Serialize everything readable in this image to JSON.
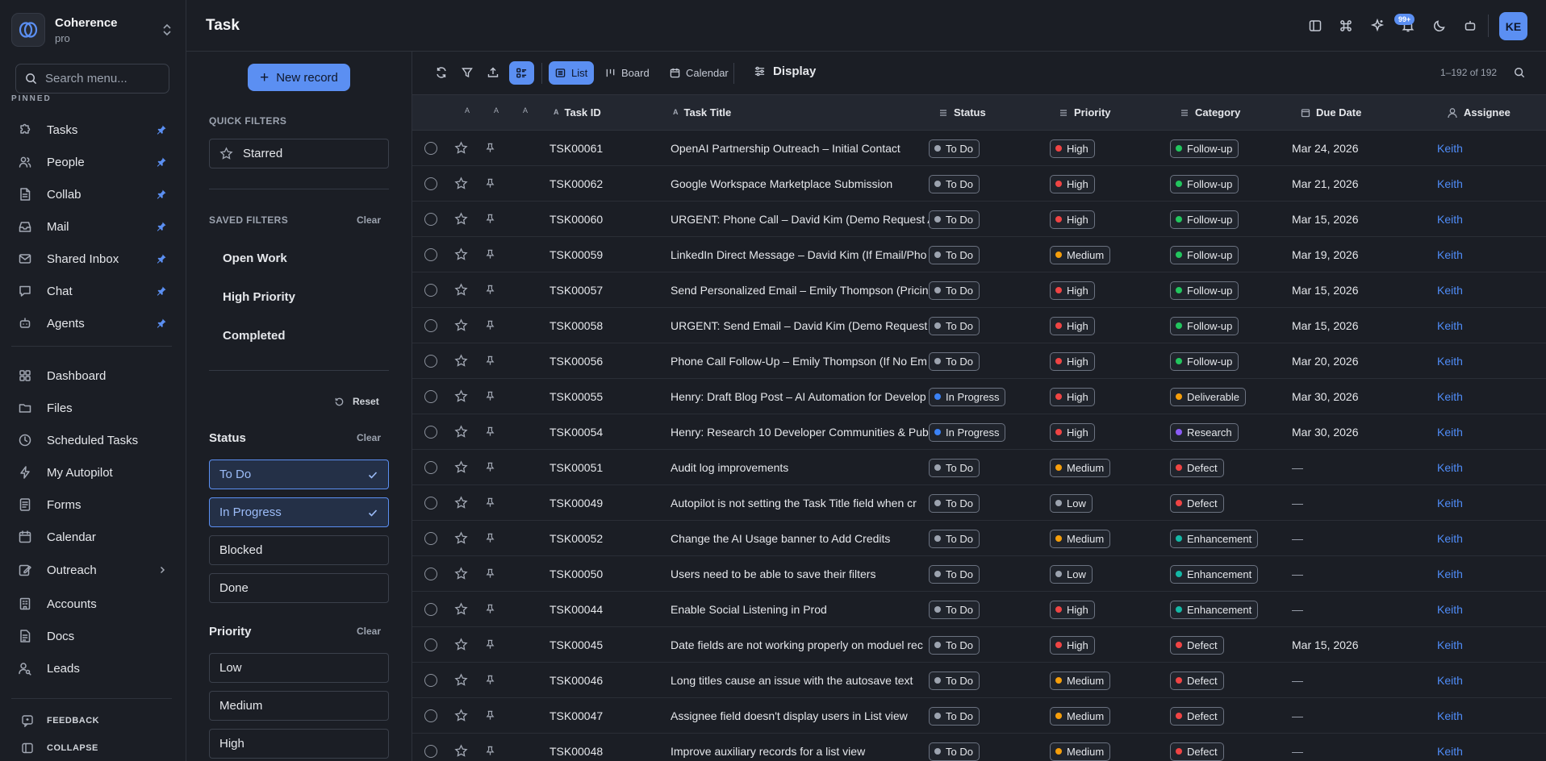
{
  "workspace": {
    "name": "Coherence",
    "plan": "pro"
  },
  "search": {
    "placeholder": "Search menu..."
  },
  "sidebar": {
    "pinned_label": "PINNED",
    "pinned": [
      {
        "label": "Tasks",
        "icon": "puzzle-icon"
      },
      {
        "label": "People",
        "icon": "users-icon"
      },
      {
        "label": "Collab",
        "icon": "document-icon"
      },
      {
        "label": "Mail",
        "icon": "inbox-icon"
      },
      {
        "label": "Shared Inbox",
        "icon": "mail-icon"
      },
      {
        "label": "Chat",
        "icon": "chat-icon"
      },
      {
        "label": "Agents",
        "icon": "bot-icon"
      }
    ],
    "items": [
      {
        "label": "Dashboard",
        "icon": "grid-icon"
      },
      {
        "label": "Files",
        "icon": "folder-icon"
      },
      {
        "label": "Scheduled Tasks",
        "icon": "clock-icon"
      },
      {
        "label": "My Autopilot",
        "icon": "bolt-icon"
      },
      {
        "label": "Forms",
        "icon": "form-icon"
      },
      {
        "label": "Calendar",
        "icon": "calendar-icon"
      },
      {
        "label": "Outreach",
        "icon": "edit-icon"
      },
      {
        "label": "Accounts",
        "icon": "building-icon"
      },
      {
        "label": "Docs",
        "icon": "file-icon"
      },
      {
        "label": "Leads",
        "icon": "user-search-icon"
      }
    ],
    "feedback": "FEEDBACK",
    "collapse": "COLLAPSE"
  },
  "header": {
    "title": "Task",
    "notification_count": "99+",
    "avatar_initials": "KE"
  },
  "filters": {
    "new_record": "New record",
    "quick_filters_label": "QUICK FILTERS",
    "starred": "Starred",
    "saved_filters_label": "SAVED FILTERS",
    "clear": "Clear",
    "saved": [
      "Open Work",
      "High Priority",
      "Completed"
    ],
    "reset": "Reset",
    "status_label": "Status",
    "status_options": [
      {
        "label": "To Do",
        "selected": true
      },
      {
        "label": "In Progress",
        "selected": true
      },
      {
        "label": "Blocked",
        "selected": false
      },
      {
        "label": "Done",
        "selected": false
      }
    ],
    "priority_label": "Priority",
    "priority_options": [
      "Low",
      "Medium",
      "High"
    ]
  },
  "toolbar": {
    "views": [
      "List",
      "Board",
      "Calendar"
    ],
    "active_view": "List",
    "display": "Display",
    "record_count": "1–192 of 192"
  },
  "table": {
    "columns": {
      "task_id": "Task ID",
      "title": "Task Title",
      "status": "Status",
      "priority": "Priority",
      "category": "Category",
      "due_date": "Due Date",
      "assignee": "Assignee"
    },
    "sort_marker": "A",
    "rows": [
      {
        "id": "TSK00061",
        "title": "OpenAI Partnership Outreach – Initial Contact",
        "status": "To Do",
        "priority": "High",
        "category": "Follow-up",
        "due": "Mar 24, 2026",
        "assignee": "Keith"
      },
      {
        "id": "TSK00062",
        "title": "Google Workspace Marketplace Submission",
        "status": "To Do",
        "priority": "High",
        "category": "Follow-up",
        "due": "Mar 21, 2026",
        "assignee": "Keith"
      },
      {
        "id": "TSK00060",
        "title": "URGENT: Phone Call – David Kim (Demo Request A",
        "status": "To Do",
        "priority": "High",
        "category": "Follow-up",
        "due": "Mar 15, 2026",
        "assignee": "Keith"
      },
      {
        "id": "TSK00059",
        "title": "LinkedIn Direct Message – David Kim (If Email/Pho",
        "status": "To Do",
        "priority": "Medium",
        "category": "Follow-up",
        "due": "Mar 19, 2026",
        "assignee": "Keith"
      },
      {
        "id": "TSK00057",
        "title": "Send Personalized Email – Emily Thompson (Pricin",
        "status": "To Do",
        "priority": "High",
        "category": "Follow-up",
        "due": "Mar 15, 2026",
        "assignee": "Keith"
      },
      {
        "id": "TSK00058",
        "title": "URGENT: Send Email – David Kim (Demo Request -",
        "status": "To Do",
        "priority": "High",
        "category": "Follow-up",
        "due": "Mar 15, 2026",
        "assignee": "Keith"
      },
      {
        "id": "TSK00056",
        "title": "Phone Call Follow-Up – Emily Thompson (If No Em",
        "status": "To Do",
        "priority": "High",
        "category": "Follow-up",
        "due": "Mar 20, 2026",
        "assignee": "Keith"
      },
      {
        "id": "TSK00055",
        "title": "Henry: Draft Blog Post – AI Automation for Develop",
        "status": "In Progress",
        "priority": "High",
        "category": "Deliverable",
        "due": "Mar 30, 2026",
        "assignee": "Keith"
      },
      {
        "id": "TSK00054",
        "title": "Henry: Research 10 Developer Communities & Pub",
        "status": "In Progress",
        "priority": "High",
        "category": "Research",
        "due": "Mar 30, 2026",
        "assignee": "Keith"
      },
      {
        "id": "TSK00051",
        "title": "Audit log improvements",
        "status": "To Do",
        "priority": "Medium",
        "category": "Defect",
        "due": "—",
        "assignee": "Keith"
      },
      {
        "id": "TSK00049",
        "title": "Autopilot is not setting the Task Title field when cr",
        "status": "To Do",
        "priority": "Low",
        "category": "Defect",
        "due": "—",
        "assignee": "Keith"
      },
      {
        "id": "TSK00052",
        "title": "Change the AI Usage banner to Add Credits",
        "status": "To Do",
        "priority": "Medium",
        "category": "Enhancement",
        "due": "—",
        "assignee": "Keith"
      },
      {
        "id": "TSK00050",
        "title": "Users need to be able to save their filters",
        "status": "To Do",
        "priority": "Low",
        "category": "Enhancement",
        "due": "—",
        "assignee": "Keith"
      },
      {
        "id": "TSK00044",
        "title": "Enable Social Listening in Prod",
        "status": "To Do",
        "priority": "High",
        "category": "Enhancement",
        "due": "—",
        "assignee": "Keith"
      },
      {
        "id": "TSK00045",
        "title": "Date fields are not working properly on moduel rec",
        "status": "To Do",
        "priority": "High",
        "category": "Defect",
        "due": "Mar 15, 2026",
        "assignee": "Keith"
      },
      {
        "id": "TSK00046",
        "title": "Long titles cause an issue with the autosave text",
        "status": "To Do",
        "priority": "Medium",
        "category": "Defect",
        "due": "—",
        "assignee": "Keith"
      },
      {
        "id": "TSK00047",
        "title": "Assignee field doesn't display users in List view",
        "status": "To Do",
        "priority": "Medium",
        "category": "Defect",
        "due": "—",
        "assignee": "Keith"
      },
      {
        "id": "TSK00048",
        "title": "Improve auxiliary records for a list view",
        "status": "To Do",
        "priority": "Medium",
        "category": "Defect",
        "due": "—",
        "assignee": "Keith"
      }
    ]
  },
  "colors": {
    "accent": "#5b8ff2",
    "status": {
      "To Do": "#9ca3af",
      "In Progress": "#3b82f6"
    },
    "priority": {
      "High": "#ef4444",
      "Medium": "#f59e0b",
      "Low": "#9ca3af"
    },
    "category": {
      "Follow-up": "#22c55e",
      "Deliverable": "#f59e0b",
      "Research": "#8b5cf6",
      "Defect": "#ef4444",
      "Enhancement": "#14b8a6"
    }
  }
}
